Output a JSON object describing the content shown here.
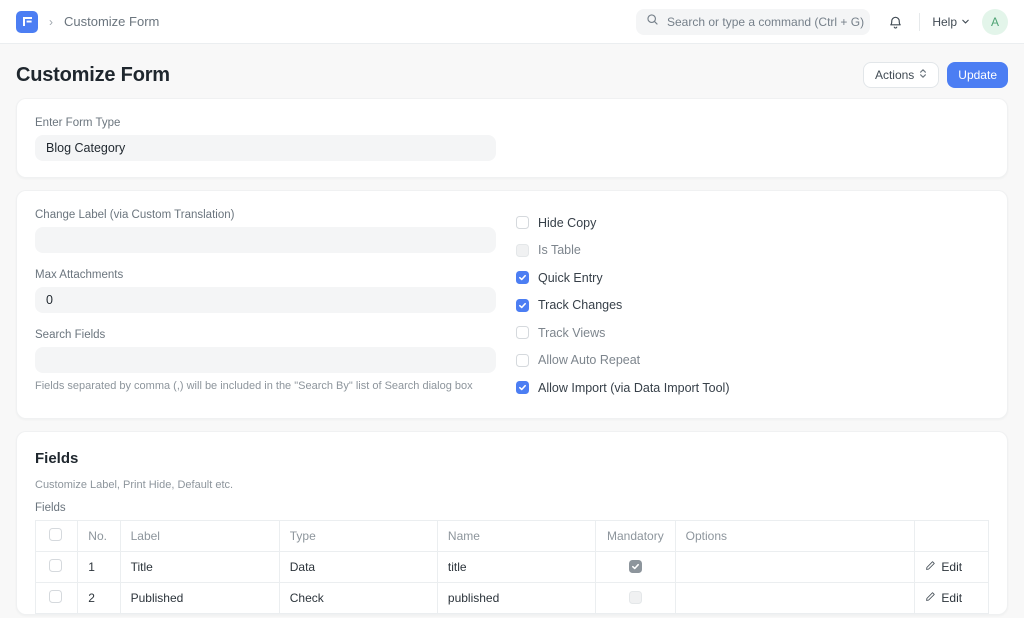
{
  "navbar": {
    "logo_icon": "frappe-logo-icon",
    "breadcrumb_separator": "›",
    "breadcrumb": "Customize Form",
    "search": {
      "icon": "search-icon",
      "placeholder": "Search or type a command (Ctrl + G)",
      "value": ""
    },
    "notifications_icon": "bell-icon",
    "help_label": "Help",
    "help_chevron_icon": "chevron-down-icon",
    "avatar_initial": "A",
    "avatar_color": "#4ea374"
  },
  "page": {
    "title": "Customize Form",
    "actions_label": "Actions",
    "actions_chevron_icon": "chevron-up-down-icon",
    "update_label": "Update",
    "primary_color": "#4c7ef3"
  },
  "form_type_card": {
    "label": "Enter Form Type",
    "value": "Blog Category",
    "placeholder": ""
  },
  "settings_card": {
    "left_fields": [
      {
        "label": "Change Label (via Custom Translation)",
        "value": "",
        "placeholder": "",
        "help": ""
      },
      {
        "label": "Max Attachments",
        "value": "0",
        "placeholder": "",
        "help": ""
      },
      {
        "label": "Search Fields",
        "value": "",
        "placeholder": "",
        "help": "Fields separated by comma (,) will be included in the \"Search By\" list of Search dialog box"
      }
    ],
    "checkboxes": [
      {
        "label": "Hide Copy",
        "checked": false,
        "disabled": false
      },
      {
        "label": "Is Table",
        "checked": false,
        "disabled": true
      },
      {
        "label": "Quick Entry",
        "checked": true,
        "disabled": false
      },
      {
        "label": "Track Changes",
        "checked": true,
        "disabled": false
      },
      {
        "label": "Track Views",
        "checked": false,
        "disabled": true
      },
      {
        "label": "Allow Auto Repeat",
        "checked": false,
        "disabled": true
      },
      {
        "label": "Allow Import (via Data Import Tool)",
        "checked": true,
        "disabled": false
      }
    ]
  },
  "fields_card": {
    "title": "Fields",
    "subtitle": "Customize Label, Print Hide, Default etc.",
    "grid_label": "Fields",
    "columns": [
      "",
      "No.",
      "Label",
      "Type",
      "Name",
      "Mandatory",
      "Options",
      ""
    ],
    "rows": [
      {
        "selected": false,
        "no": "1",
        "label": "Title",
        "type": "Data",
        "name": "title",
        "mandatory": true,
        "mandatory_disabled": true,
        "options": "",
        "action": "Edit",
        "action_icon": "pencil-icon"
      },
      {
        "selected": false,
        "no": "2",
        "label": "Published",
        "type": "Check",
        "name": "published",
        "mandatory": false,
        "mandatory_disabled": true,
        "options": "",
        "action": "Edit",
        "action_icon": "pencil-icon"
      }
    ]
  }
}
